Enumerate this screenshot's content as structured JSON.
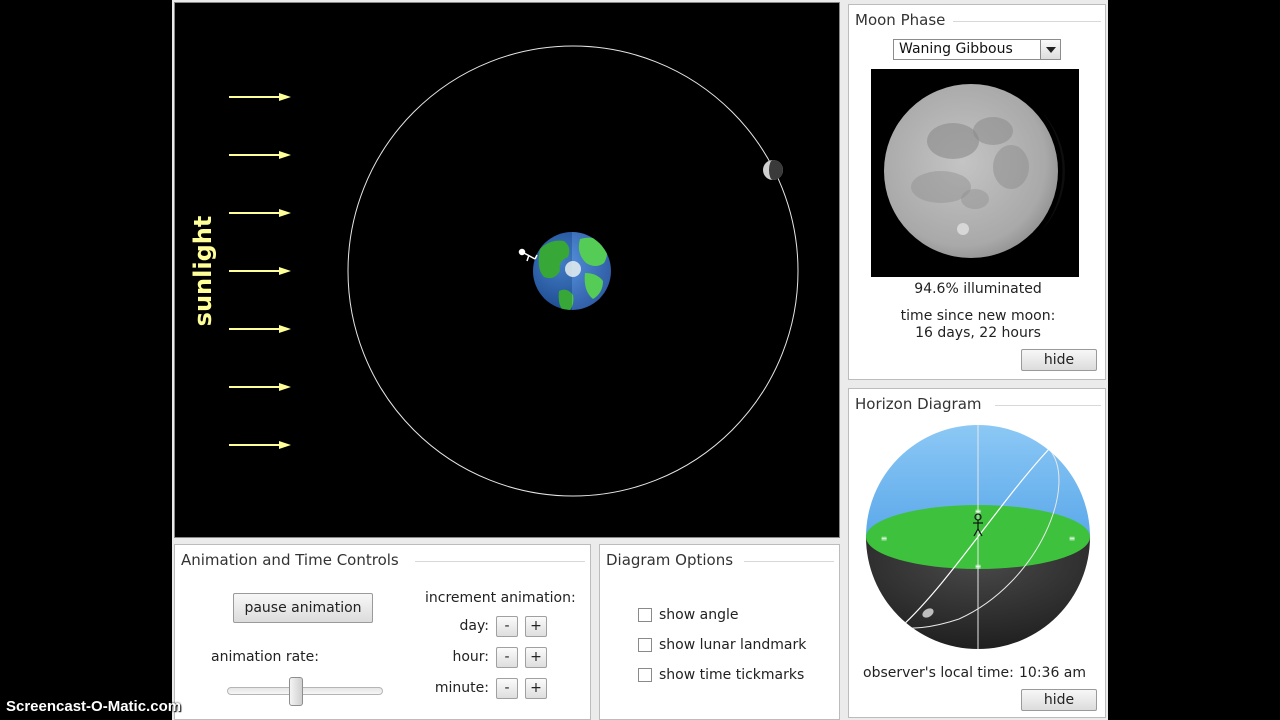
{
  "orbit_view": {
    "sunlight_label": "sunlight"
  },
  "moon_phase": {
    "title": "Moon Phase",
    "selected_phase": "Waning Gibbous",
    "illuminated": "94.6% illuminated",
    "time_since_label": "time since new moon:",
    "time_since_value": "16 days, 22 hours",
    "hide_label": "hide"
  },
  "horizon": {
    "title": "Horizon Diagram",
    "local_time_label": "observer's local time:",
    "local_time_value": "10:36 am",
    "hide_label": "hide"
  },
  "animation": {
    "title": "Animation and Time Controls",
    "pause_label": "pause animation",
    "rate_label": "animation rate:",
    "rate_fraction": 0.44,
    "increment_label": "increment animation:",
    "rows": [
      {
        "label": "day:",
        "minus": "-",
        "plus": "+"
      },
      {
        "label": "hour:",
        "minus": "-",
        "plus": "+"
      },
      {
        "label": "minute:",
        "minus": "-",
        "plus": "+"
      }
    ]
  },
  "diagram_options": {
    "title": "Diagram Options",
    "options": [
      {
        "label": "show angle",
        "checked": false
      },
      {
        "label": "show lunar landmark",
        "checked": false
      },
      {
        "label": "show time tickmarks",
        "checked": false
      }
    ]
  },
  "watermark": "Screencast-O-Matic.com",
  "colors": {
    "sunlight": "#ffff99",
    "sky": "#6cb4f0",
    "ground": "#3ec23e",
    "ocean": "#2a68c8"
  }
}
